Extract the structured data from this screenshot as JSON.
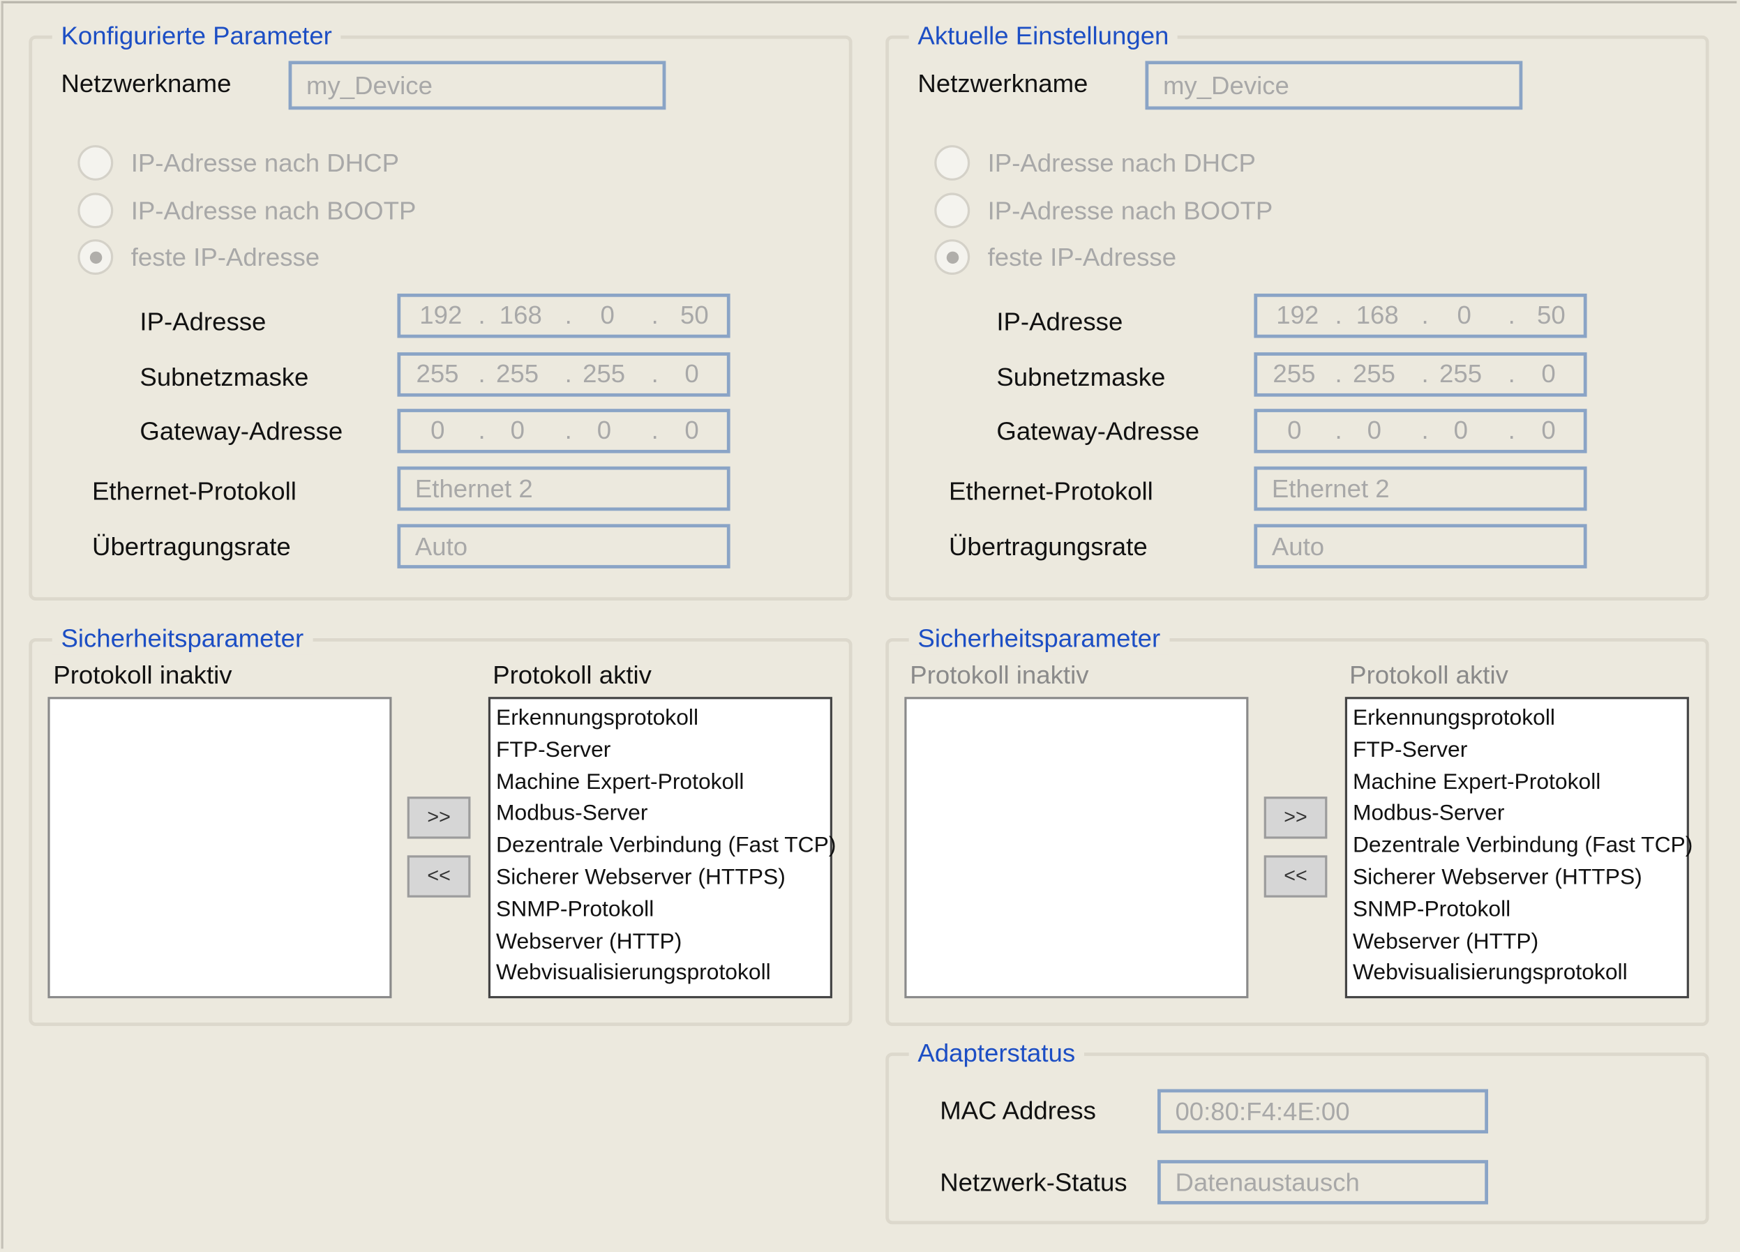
{
  "configured": {
    "legend": "Konfigurierte Parameter",
    "network_name_label": "Netzwerkname",
    "network_name_value": "my_Device",
    "radio_dhcp": "IP-Adresse nach DHCP",
    "radio_bootp": "IP-Adresse nach BOOTP",
    "radio_fixed": "feste IP-Adresse",
    "selected_mode": "feste IP-Adresse",
    "ip_label": "IP-Adresse",
    "ip": [
      "192",
      "168",
      "0",
      "50"
    ],
    "subnet_label": "Subnetzmaske",
    "subnet": [
      "255",
      "255",
      "255",
      "0"
    ],
    "gateway_label": "Gateway-Adresse",
    "gateway": [
      "0",
      "0",
      "0",
      "0"
    ],
    "ethernet_label": "Ethernet-Protokoll",
    "ethernet_value": "Ethernet 2",
    "rate_label": "Übertragungsrate",
    "rate_value": "Auto"
  },
  "current": {
    "legend": "Aktuelle Einstellungen",
    "network_name_label": "Netzwerkname",
    "network_name_value": "my_Device",
    "radio_dhcp": "IP-Adresse nach DHCP",
    "radio_bootp": "IP-Adresse nach BOOTP",
    "radio_fixed": "feste IP-Adresse",
    "selected_mode": "feste IP-Adresse",
    "ip_label": "IP-Adresse",
    "ip": [
      "192",
      "168",
      "0",
      "50"
    ],
    "subnet_label": "Subnetzmaske",
    "subnet": [
      "255",
      "255",
      "255",
      "0"
    ],
    "gateway_label": "Gateway-Adresse",
    "gateway": [
      "0",
      "0",
      "0",
      "0"
    ],
    "ethernet_label": "Ethernet-Protokoll",
    "ethernet_value": "Ethernet 2",
    "rate_label": "Übertragungsrate",
    "rate_value": "Auto"
  },
  "security_left": {
    "legend": "Sicherheitsparameter",
    "inactive_label": "Protokoll inaktiv",
    "active_label": "Protokoll aktiv",
    "inactive_items": [],
    "active_items": [
      "Erkennungsprotokoll",
      "FTP-Server",
      "Machine Expert-Protokoll",
      "Modbus-Server",
      "Dezentrale Verbindung (Fast TCP)",
      "Sicherer Webserver (HTTPS)",
      "SNMP-Protokoll",
      "Webserver (HTTP)",
      "Webvisualisierungsprotokoll"
    ],
    "move_right_label": ">>",
    "move_left_label": "<<"
  },
  "security_right": {
    "legend": "Sicherheitsparameter",
    "inactive_label": "Protokoll inaktiv",
    "active_label": "Protokoll aktiv",
    "inactive_items": [],
    "active_items": [
      "Erkennungsprotokoll",
      "FTP-Server",
      "Machine Expert-Protokoll",
      "Modbus-Server",
      "Dezentrale Verbindung (Fast TCP)",
      "Sicherer Webserver (HTTPS)",
      "SNMP-Protokoll",
      "Webserver (HTTP)",
      "Webvisualisierungsprotokoll"
    ],
    "move_right_label": ">>",
    "move_left_label": "<<"
  },
  "adapter": {
    "legend": "Adapterstatus",
    "mac_label": "MAC Address",
    "mac_value": "00:80:F4:4E:00",
    "status_label": "Netzwerk-Status",
    "status_value": "Datenaustausch"
  },
  "colors": {
    "background": "#ece9de",
    "legend_text": "#1c4ec4",
    "field_border": "#8aa4c6",
    "disabled_text": "#a8a8a8"
  }
}
